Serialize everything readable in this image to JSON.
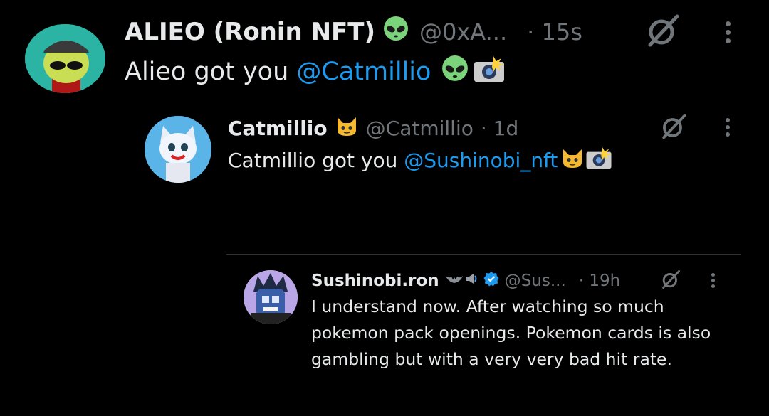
{
  "tweets": [
    {
      "author": "ALIEO (Ronin NFT)",
      "handle": "@0xA...",
      "time": "· 15s",
      "text_prefix": "Alieo got you ",
      "mention": "@Catmillio",
      "avatar_color": "#2bb3a3"
    },
    {
      "author": "Catmillio",
      "handle": "@Catmillio",
      "time": "· 1d",
      "text_prefix": "Catmillio got you ",
      "mention": "@Sushinobi_nft",
      "avatar_color": "#5bb4e8"
    },
    {
      "author": "Sushinobi.ron",
      "handle": "@Sus...",
      "time": "· 19h",
      "text": "I understand now. After watching so much pokemon pack openings. Pokemon cards is also gambling but with a very very bad hit rate.",
      "avatar_color": "#b9a6e6"
    }
  ],
  "icons": {
    "alien": "alien-emoji",
    "camera": "camera-flash-emoji",
    "cat": "cat-emoji",
    "grok": "grok-slash-icon",
    "more": "more-vertical-icon",
    "verified": "verified-badge-icon"
  },
  "colors": {
    "background": "#000000",
    "text": "#e7e9ea",
    "muted": "#71767b",
    "link": "#1d9bf0",
    "verified": "#1d9bf0"
  }
}
